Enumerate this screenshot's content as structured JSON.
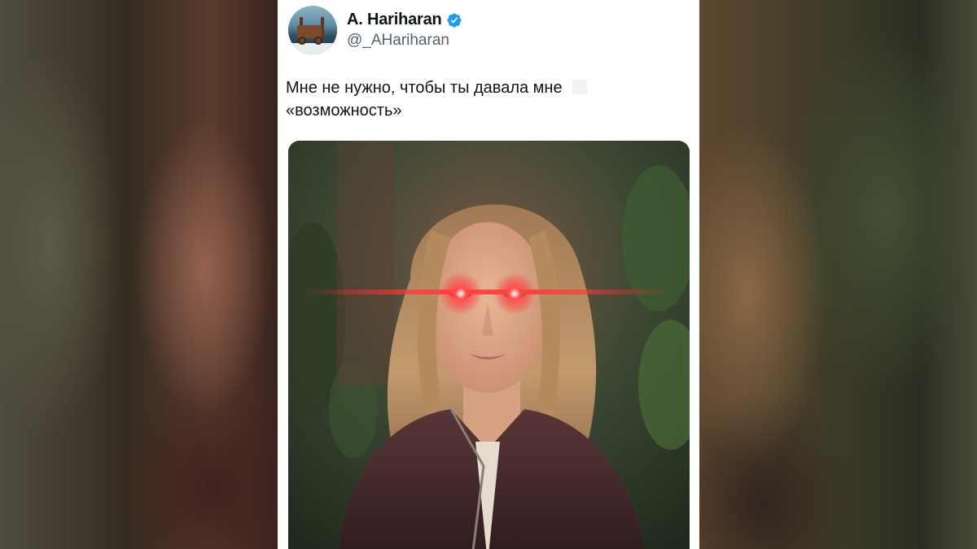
{
  "tweet": {
    "author": {
      "display_name": "A. Hariharan",
      "handle": "@_AHariharan",
      "verified": true,
      "verified_color": "#1d9bf0",
      "avatar": "avatar-photo"
    },
    "text_line1": "Мне не нужно, чтобы ты давала мне",
    "text_line2": "«возможность»",
    "media": {
      "kind": "photo",
      "subject": "woman-laser-eyes-meme",
      "laser_color": "#ff2b2b"
    }
  },
  "colors": {
    "text_primary": "#0f1419",
    "text_secondary": "#536471",
    "card_bg": "#ffffff"
  }
}
